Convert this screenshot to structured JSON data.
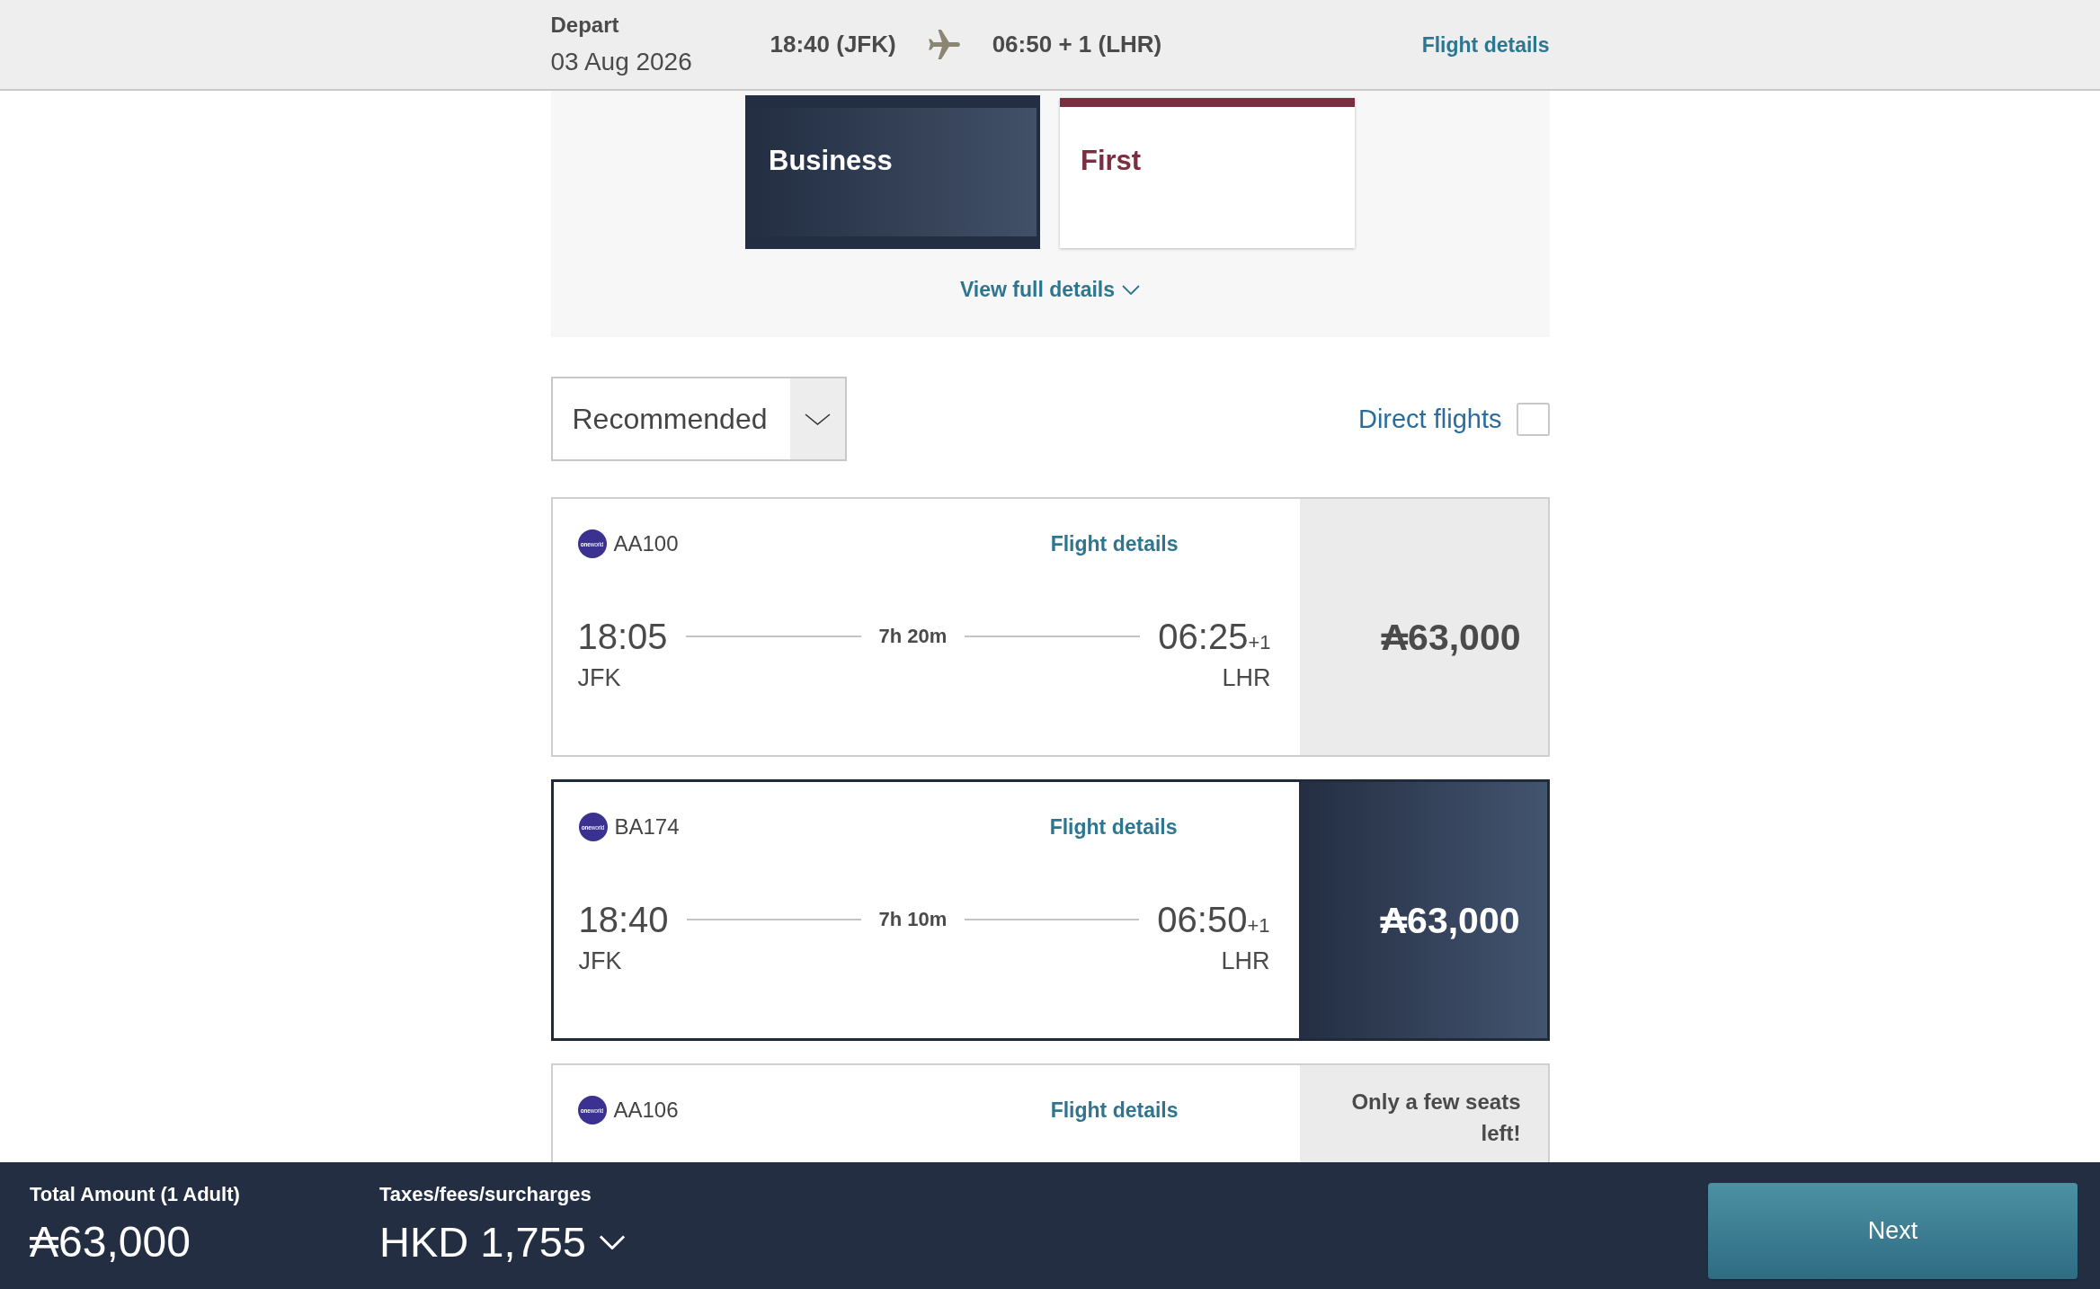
{
  "header": {
    "depart_label": "Depart",
    "date": "03 Aug 2026",
    "departure": "18:40 (JFK)",
    "arrival": "06:50 + 1 (LHR)",
    "details_link": "Flight details"
  },
  "cabin_tabs": [
    {
      "label": "Business",
      "selected": true,
      "color": "#232e42"
    },
    {
      "label": "First",
      "selected": false,
      "color": "#7b2e40"
    }
  ],
  "view_details_link": "View full details",
  "sort": {
    "value": "Recommended"
  },
  "direct_flights": {
    "label": "Direct flights",
    "checked": false
  },
  "flights": [
    {
      "alliance_logo": "**one**world",
      "flight_number": "AA100",
      "details_link": "Flight details",
      "departure_time": "18:05",
      "origin": "JFK",
      "duration": "7h 20m",
      "arrival_time": "06:25",
      "day_offset": "+1",
      "destination": "LHR",
      "price": "₳63,000",
      "selected": false
    },
    {
      "alliance_logo": "**one**world",
      "flight_number": "BA174",
      "details_link": "Flight details",
      "departure_time": "18:40",
      "origin": "JFK",
      "duration": "7h 10m",
      "arrival_time": "06:50",
      "day_offset": "+1",
      "destination": "LHR",
      "price": "₳63,000",
      "selected": true
    },
    {
      "alliance_logo": "**one**world",
      "flight_number": "AA106",
      "details_link": "Flight details",
      "note": "Only a few seats left!",
      "selected": false
    }
  ],
  "footer": {
    "total_label": "Total Amount (1 Adult)",
    "total": "₳63,000",
    "taxes_label": "Taxes/fees/surcharges",
    "taxes": "HKD 1,755",
    "next_button": "Next"
  }
}
